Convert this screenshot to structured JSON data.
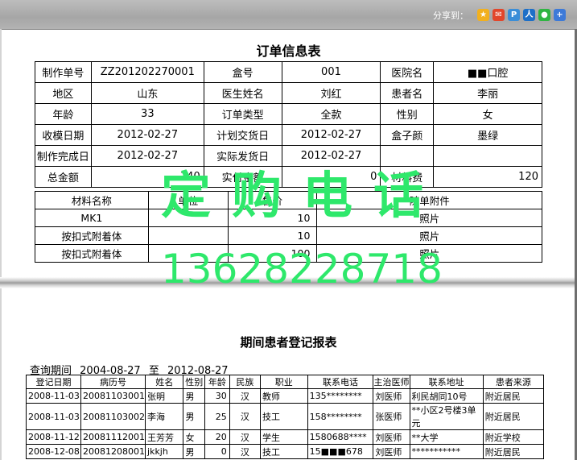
{
  "share": {
    "label": "分享到：",
    "icons": [
      {
        "name": "star-icon",
        "color": "#f2b01e",
        "glyph": "★"
      },
      {
        "name": "sina-icon",
        "color": "#e2462b",
        "glyph": "✉"
      },
      {
        "name": "p-icon",
        "color": "#3a8ed8",
        "glyph": "P"
      },
      {
        "name": "renren-icon",
        "color": "#1d6fc7",
        "glyph": "人"
      },
      {
        "name": "wechat-icon",
        "color": "#2fb542",
        "glyph": "●"
      },
      {
        "name": "plus-icon",
        "color": "#3d7ad8",
        "glyph": "+"
      }
    ]
  },
  "order": {
    "title": "订单信息表",
    "rows": [
      [
        "制作单号",
        "ZZ201202270001",
        "盒号",
        "001",
        "医院名",
        "■■口腔"
      ],
      [
        "地区",
        "山东",
        "医生姓名",
        "刘红",
        "患者名",
        "李丽"
      ],
      [
        "年龄",
        "33",
        "订单类型",
        "全款",
        "性别",
        "女"
      ],
      [
        "收模日期",
        "2012-02-27",
        "计划交货日",
        "2012-02-27",
        "盒子颜",
        "墨绿"
      ],
      [
        "制作完成日",
        "2012-02-27",
        "实际发货日",
        "2012-02-27",
        "",
        ""
      ],
      [
        "总金额",
        "140",
        "实付金额",
        "0",
        "材料费",
        "120"
      ]
    ],
    "material_headers": [
      "材料名称",
      "单位",
      "售价",
      "随单附件"
    ],
    "materials": [
      [
        "MK1",
        "",
        "10",
        "照片"
      ],
      [
        "按扣式附着体",
        "",
        "10",
        "照片"
      ],
      [
        "按扣式附着体",
        "",
        "100",
        "照片"
      ]
    ]
  },
  "watermark": {
    "line1": "定购电话",
    "line2": "13628228718"
  },
  "report": {
    "title": "期间患者登记报表",
    "query_label": "查询期间",
    "from": "2004-08-27",
    "to_label": "至",
    "to": "2012-08-27",
    "headers": [
      "登记日期",
      "病历号",
      "姓名",
      "性别",
      "年龄",
      "民族",
      "职业",
      "联系电话",
      "主治医师",
      "联系地址",
      "患者来源"
    ],
    "rows": [
      [
        "2008-11-03",
        "20081103001",
        "张明",
        "男",
        "30",
        "汉",
        "教师",
        "135********",
        "刘医师",
        "利民胡同10号",
        "附近居民"
      ],
      [
        "2008-11-03",
        "20081103002",
        "李海",
        "男",
        "25",
        "汉",
        "技工",
        "158********",
        "张医师",
        "**小区2号楼3单元",
        "附近居民"
      ],
      [
        "2008-11-12",
        "20081112001",
        "王芳芳",
        "女",
        "20",
        "汉",
        "学生",
        "1580688****",
        "刘医师",
        "**大学",
        "附近学校"
      ],
      [
        "2008-12-08",
        "20081208001",
        "jkkjh",
        "男",
        "0",
        "汉",
        "技工",
        "15■■■678",
        "刘医师",
        "***********",
        "附近居民"
      ]
    ]
  }
}
